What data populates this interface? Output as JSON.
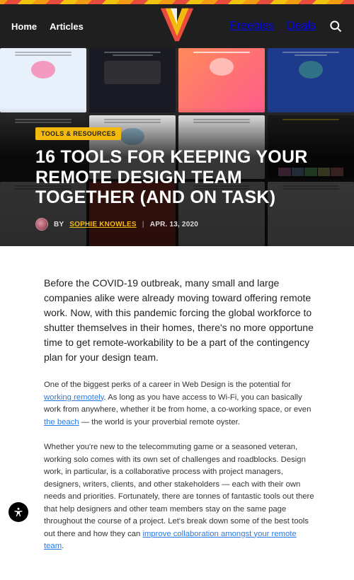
{
  "nav": {
    "left": [
      {
        "label": "Home"
      },
      {
        "label": "Articles"
      }
    ],
    "right": [
      {
        "label": "Freebies"
      },
      {
        "label": "Deals"
      }
    ]
  },
  "article": {
    "category": "TOOLS & RESOURCES",
    "title": "16 TOOLS FOR KEEPING YOUR REMOTE DESIGN TEAM TOGETHER (AND ON TASK)",
    "by_label": "BY",
    "author": "SOPHIE KNOWLES",
    "date": "APR. 13, 2020",
    "lead": "Before the COVID-19 outbreak, many small and large companies alike were already moving toward offering remote work. Now, with this pandemic forcing the global workforce to shutter themselves in their homes, there's no more opportune time to get remote-workability to be a part of the contingency plan for your design team.",
    "p2_parts": {
      "a": "One of the biggest perks of a career in Web Design is the potential for ",
      "link1": "working remotely",
      "b": ". As long as you have access to Wi-Fi, you can basically work from anywhere, whether it be from home, a co-working space, or even ",
      "link2": "the beach",
      "c": " — the world is your proverbial remote oyster."
    },
    "p3_parts": {
      "a": "Whether you're new to the telecommuting game or a seasoned veteran, working solo comes with its own set of challenges and roadblocks. Design work, in particular, is a collaborative process with project managers, designers, writers, clients, and other stakeholders — each with their own needs and priorities. Fortunately, there are tonnes of fantastic tools out there that help designers and other team members stay on the same page throughout the course of a project. Let's break down some of the best tools out there and how they can ",
      "link1": "improve collaboration amongst your remote team",
      "b": "."
    }
  }
}
